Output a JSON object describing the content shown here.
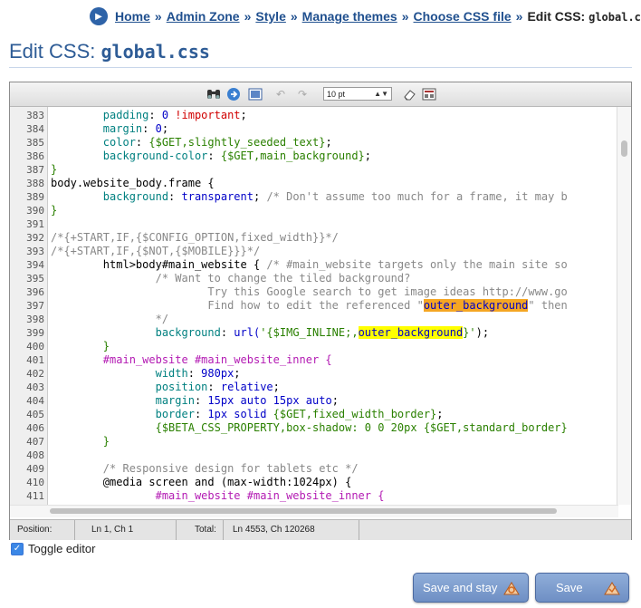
{
  "breadcrumb": {
    "items": [
      "Home",
      "Admin Zone",
      "Style",
      "Manage themes",
      "Choose CSS file"
    ],
    "separator": "»",
    "current_label": "Edit CSS:",
    "current_file": "global.css"
  },
  "title": {
    "label": "Edit CSS:",
    "file": "global.css"
  },
  "toolbar": {
    "font_size": "10 pt",
    "icons": [
      "binoculars-icon",
      "goto-icon",
      "fullscreen-icon",
      "undo-icon",
      "redo-icon",
      "eraser-icon",
      "toggle-highlight-icon"
    ]
  },
  "code_lines": [
    {
      "n": "383"
    },
    {
      "n": "384"
    },
    {
      "n": "385"
    },
    {
      "n": "386"
    },
    {
      "n": "387"
    },
    {
      "n": "388"
    },
    {
      "n": "389"
    },
    {
      "n": "390"
    },
    {
      "n": "391"
    },
    {
      "n": "392"
    },
    {
      "n": "393"
    },
    {
      "n": "394"
    },
    {
      "n": "395"
    },
    {
      "n": "396"
    },
    {
      "n": "397"
    },
    {
      "n": "398"
    },
    {
      "n": "399"
    },
    {
      "n": "400"
    },
    {
      "n": "401"
    },
    {
      "n": "402"
    },
    {
      "n": "403"
    },
    {
      "n": "404"
    },
    {
      "n": "405"
    },
    {
      "n": "406"
    },
    {
      "n": "407"
    },
    {
      "n": "408"
    },
    {
      "n": "409"
    },
    {
      "n": "410"
    },
    {
      "n": "411"
    }
  ],
  "code": {
    "l383a": "        ",
    "l383b": "padding",
    "l383c": ": ",
    "l383d": "0",
    "l383e": " !important",
    "l383f": ";",
    "l384a": "        ",
    "l384b": "margin",
    "l384c": ": ",
    "l384d": "0",
    "l384e": ";",
    "l385a": "        ",
    "l385b": "color",
    "l385c": ": ",
    "l385d": "{$GET,slightly_seeded_text}",
    "l385e": ";",
    "l386a": "        ",
    "l386b": "background-color",
    "l386c": ": ",
    "l386d": "{$GET,main_background}",
    "l386e": ";",
    "l387": "}",
    "l388": "body.website_body.frame {",
    "l389a": "        ",
    "l389b": "background",
    "l389c": ": ",
    "l389d": "transparent",
    "l389e": "; ",
    "l389f": "/* Don't assume too much for a frame, it may b",
    "l390": "}",
    "l391": "",
    "l392": "/*{+START,IF,{$CONFIG_OPTION,fixed_width}}*/",
    "l393": "/*{+START,IF,{$NOT,{$MOBILE}}}*/",
    "l394a": "        html>body#main_website { ",
    "l394b": "/* #main_website targets only the main site so",
    "l395": "                /* Want to change the tiled background?",
    "l396": "                        Try this Google search to get image ideas http://www.go",
    "l397a": "                        Find how to edit the referenced \"",
    "l397b": "outer_background",
    "l397c": "\" then",
    "l398": "                */",
    "l399a": "                ",
    "l399b": "background",
    "l399c": ": ",
    "l399d": "url(",
    "l399e": "'{$IMG_INLINE;,",
    "l399f": "outer_background",
    "l399g": "}'",
    "l399h": ");",
    "l400": "        }",
    "l401a": "        #main_website #main_website_inner {",
    "l402a": "                ",
    "l402b": "width",
    "l402c": ": ",
    "l402d": "980px",
    "l402e": ";",
    "l403a": "                ",
    "l403b": "position",
    "l403c": ": ",
    "l403d": "relative",
    "l403e": ";",
    "l404a": "                ",
    "l404b": "margin",
    "l404c": ": ",
    "l404d": "15px auto 15px auto",
    "l404e": ";",
    "l405a": "                ",
    "l405b": "border",
    "l405c": ": ",
    "l405d": "1px solid ",
    "l405e": "{$GET,fixed_width_border}",
    "l405f": ";",
    "l406a": "                ",
    "l406b": "{$BETA_CSS_PROPERTY,box-shadow: 0 0 20px ",
    "l406c": "{$GET,standard_border}",
    "l407": "        }",
    "l408": "",
    "l409": "        /* Responsive design for tablets etc */",
    "l410": "        @media screen and (max-width:1024px) {",
    "l411": "                #main_website #main_website_inner {"
  },
  "status": {
    "position_label": "Position:",
    "position_value": "Ln 1, Ch 1",
    "total_label": "Total:",
    "total_value": "Ln 4553, Ch 120268"
  },
  "toggle": {
    "label": "Toggle editor",
    "checked": true
  },
  "buttons": {
    "save_and_stay": "Save and stay",
    "save": "Save"
  }
}
